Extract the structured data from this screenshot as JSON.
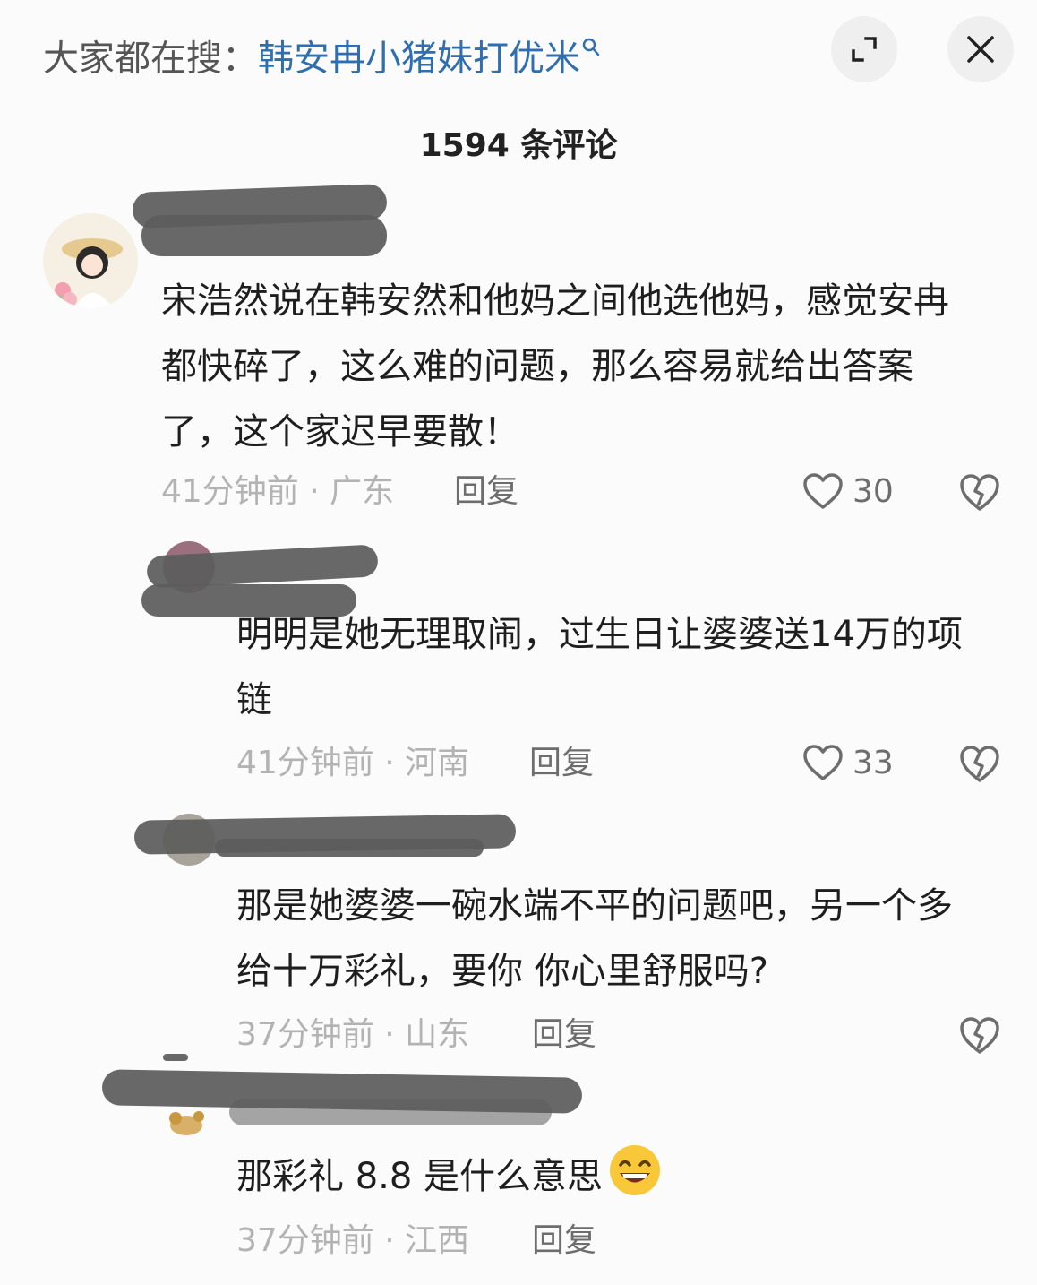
{
  "header": {
    "search_prefix": "大家都在搜：",
    "search_keyword": "韩安冉小猪妹打优米",
    "search_icon": "search-icon",
    "expand_icon": "expand-icon",
    "close_icon": "close-icon"
  },
  "comment_count": "1594 条评论",
  "comments": [
    {
      "text": "宋浩然说在韩安然和他妈之间他选他妈，感觉安冉都快碎了，这么难的问题，那么容易就给出答案了，这个家迟早要散！",
      "time_location": "41分钟前 · 广东",
      "reply": "回复",
      "likes": "30"
    },
    {
      "text": "明明是她无理取闹，过生日让婆婆送14万的项链",
      "time_location": "41分钟前 · 河南",
      "reply": "回复",
      "likes": "33"
    },
    {
      "text": "那是她婆婆一碗水端不平的问题吧，另一个多给十万彩礼，要你 你心里舒服吗?",
      "time_location": "37分钟前 · 山东",
      "reply": "回复"
    },
    {
      "text": "那彩礼 8.8 是什么意思",
      "emoji": "grinning-face-emoji",
      "time_location": "37分钟前 · 江西",
      "reply": "回复"
    }
  ],
  "colors": {
    "accent": "#2f6fb0",
    "muted": "#b3b3b3",
    "redaction": "#5c5c5c"
  }
}
